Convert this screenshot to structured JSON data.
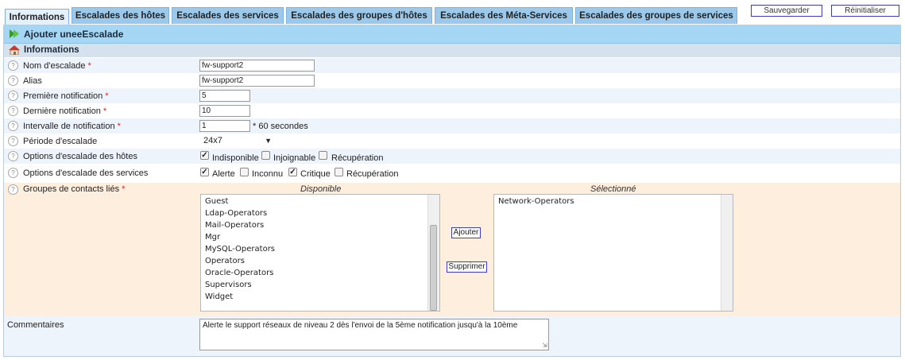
{
  "tabs": [
    "Informations",
    "Escalades des hôtes",
    "Escalades des services",
    "Escalades des groupes d'hôtes",
    "Escalades des Méta-Services",
    "Escalades des groupes de services"
  ],
  "buttons": {
    "save": "Sauvegarder",
    "reset": "Réinitialiser"
  },
  "title": "Ajouter uneeEscalade",
  "section": "Informations",
  "fields": {
    "name": {
      "label": "Nom d'escalade",
      "value": "fw-support2"
    },
    "alias": {
      "label": "Alias",
      "value": "fw-support2"
    },
    "first": {
      "label": "Première notification",
      "value": "5"
    },
    "last": {
      "label": "Dernière notification",
      "value": "10"
    },
    "interval": {
      "label": "Intervalle de notification",
      "value": "1",
      "unit": "* 60 secondes"
    },
    "period": {
      "label": "Période d'escalade",
      "value": "24x7"
    },
    "host_opts": {
      "label": "Options d'escalade des hôtes",
      "options": [
        "Indisponible",
        "Injoignable",
        "Récupération"
      ]
    },
    "svc_opts": {
      "label": "Options d'escalade des services",
      "options": [
        "Alerte",
        "Inconnu",
        "Critique",
        "Récupération"
      ]
    },
    "contacts": {
      "label": "Groupes de contacts liés"
    },
    "comments": {
      "label": "Commentaires",
      "value": "Alerte le support réseaux de niveau 2 dès l'envoi de la 5ème notification jusqu'à la 10ème"
    }
  },
  "required_mark": "*",
  "contact_groups": {
    "available_title": "Disponible",
    "selected_title": "Sélectionné",
    "available": [
      "Guest",
      "Ldap-Operators",
      "Mail-Operators",
      "Mgr",
      "MySQL-Operators",
      "Operators",
      "Oracle-Operators",
      "Supervisors",
      "Widget"
    ],
    "selected": [
      "Network-Operators"
    ],
    "add": "Ajouter",
    "remove": "Supprimer"
  }
}
